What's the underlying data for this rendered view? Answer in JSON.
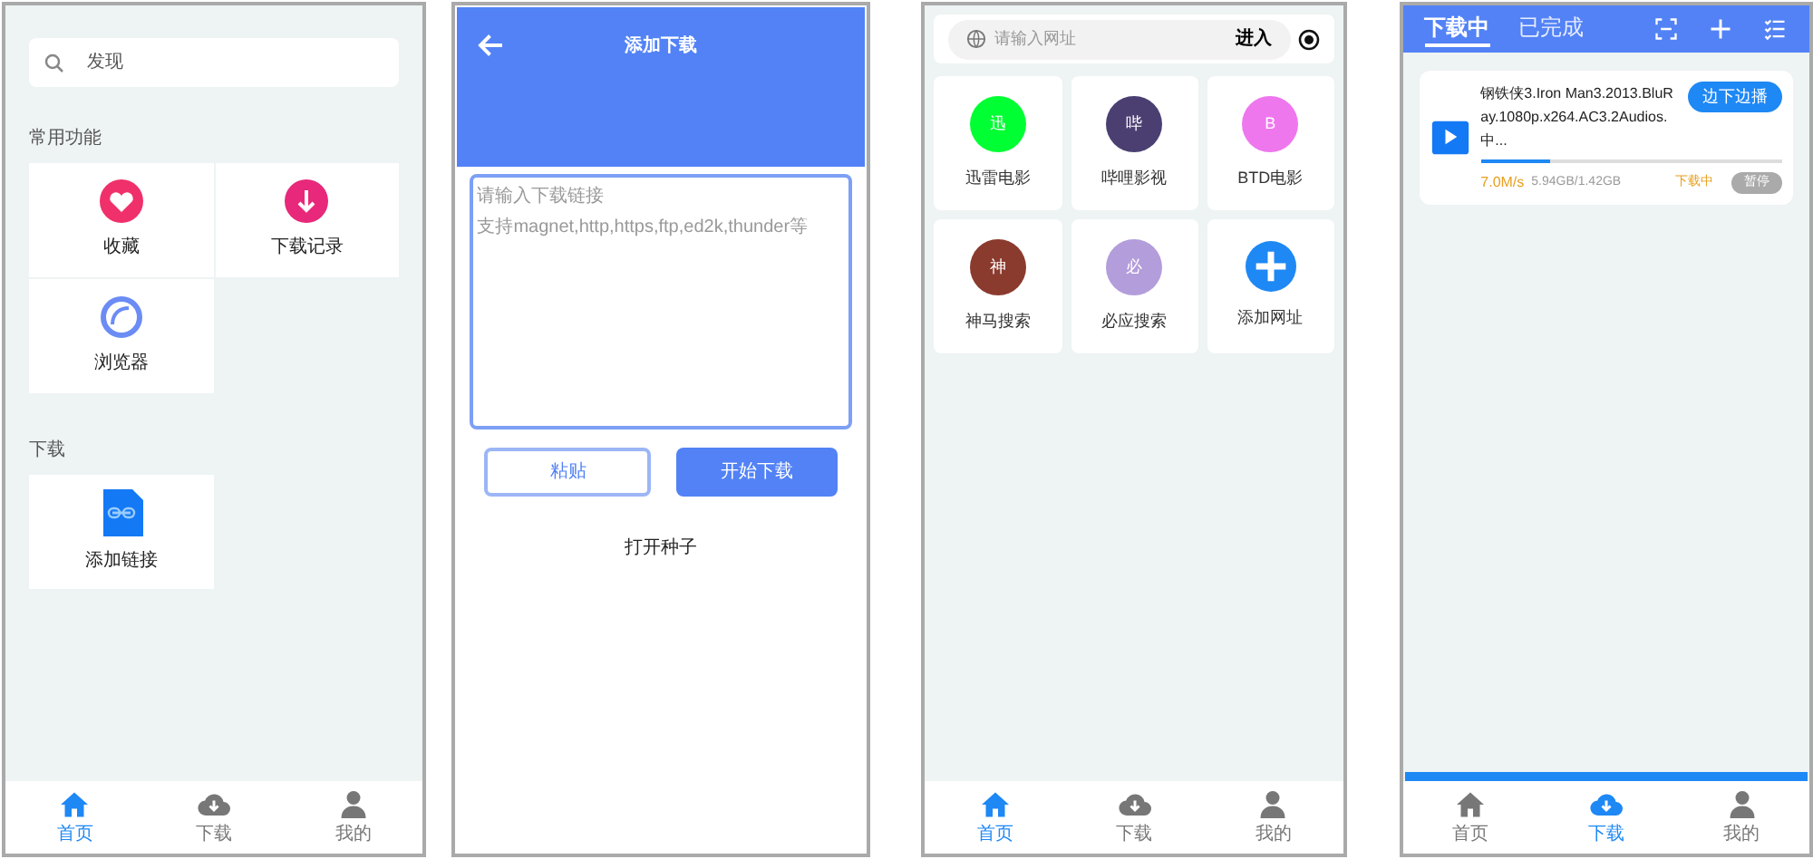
{
  "home": {
    "search": {
      "placeholder": "发现"
    },
    "sections": [
      {
        "title": "常用功能",
        "items": [
          {
            "label": "收藏",
            "kind": "heart"
          },
          {
            "label": "下载记录",
            "kind": "download"
          },
          {
            "label": "浏览器",
            "kind": "browser"
          }
        ]
      },
      {
        "title": "下载",
        "items": [
          {
            "label": "添加链接",
            "kind": "link"
          }
        ]
      }
    ],
    "nav": [
      {
        "label": "首页",
        "kind": "home",
        "selected": true
      },
      {
        "label": "下载",
        "kind": "cloud",
        "selected": false
      },
      {
        "label": "我的",
        "kind": "user",
        "selected": false
      }
    ]
  },
  "add_download": {
    "title": "添加下载",
    "input": {
      "placeholder_lines": [
        "请输入下载链接",
        "支持magnet,http,https,ftp,ed2k,thunder等"
      ]
    },
    "buttons": [
      {
        "label": "粘贴",
        "kind": "outline"
      },
      {
        "label": "开始下载",
        "kind": "solid"
      }
    ],
    "link": "打开种子"
  },
  "sites": {
    "url": {
      "placeholder": "请输入网址"
    },
    "go": "进入",
    "items": [
      {
        "label": "迅雷电影",
        "badge": "迅",
        "color": "#00ff33",
        "kind": "site"
      },
      {
        "label": "哔哩影视",
        "badge": "哔",
        "color": "#4b3f72",
        "kind": "site"
      },
      {
        "label": "BTD电影",
        "badge": "B",
        "color": "#ee77ee",
        "kind": "site"
      },
      {
        "label": "神马搜索",
        "badge": "神",
        "color": "#8b3a2e",
        "kind": "site"
      },
      {
        "label": "必应搜索",
        "badge": "必",
        "color": "#b39ddb",
        "kind": "site"
      },
      {
        "label": "添加网址",
        "kind": "add"
      }
    ],
    "nav": [
      {
        "label": "首页",
        "kind": "home",
        "selected": true
      },
      {
        "label": "下载",
        "kind": "cloud",
        "selected": false
      },
      {
        "label": "我的",
        "kind": "user",
        "selected": false
      }
    ]
  },
  "downloads": {
    "tabs": [
      {
        "label": "下载中",
        "selected": true
      },
      {
        "label": "已完成",
        "selected": false
      }
    ],
    "tasks": [
      {
        "name": "钢铁侠3.Iron Man3.2013.BluRay.1080p.x264.AC3.2Audios.中...",
        "play": "边下边播",
        "level": 0.23,
        "speed": "7.0M/s",
        "size": "5.94GB/1.42GB",
        "status": "下载中",
        "action": "暂停"
      }
    ],
    "nav": [
      {
        "label": "首页",
        "kind": "home",
        "selected": false
      },
      {
        "label": "下载",
        "kind": "cloud",
        "selected": true
      },
      {
        "label": "我的",
        "kind": "user",
        "selected": false
      }
    ]
  }
}
